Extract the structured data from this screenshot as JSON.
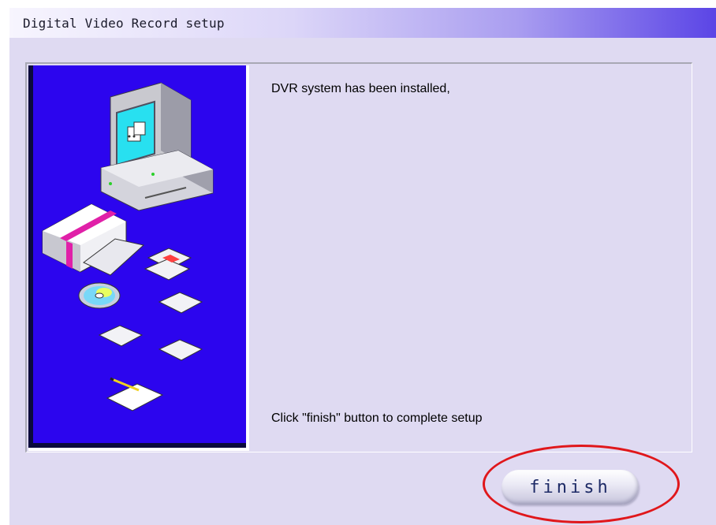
{
  "window": {
    "title": "Digital Video Record setup"
  },
  "content": {
    "message": "DVR system has been installed,",
    "instruction": "Click \"finish\" button to complete setup"
  },
  "actions": {
    "finish_label": "finish"
  },
  "icons": {
    "side_image": "computer-with-disks-illustration"
  },
  "colors": {
    "title_gradient_end": "#5b45e6",
    "side_image_bg": "#2c05ee",
    "window_bg": "#dfdaf2",
    "highlight_ring": "#e0171b"
  }
}
